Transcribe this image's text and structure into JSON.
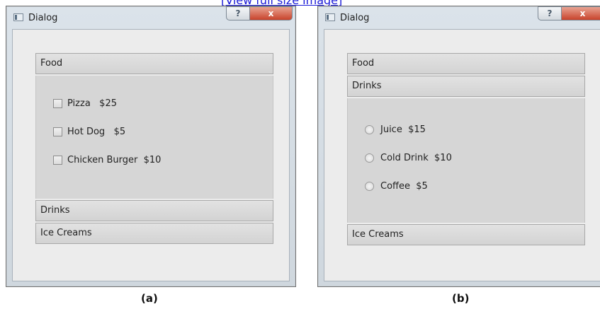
{
  "top_link": "[View full size image]",
  "windows": [
    {
      "title": "Dialog",
      "help_label": "?",
      "close_label": "x",
      "sections": [
        "Food",
        "Drinks",
        "Ice Creams"
      ],
      "options": [
        "Pizza   $25",
        "Hot Dog   $5",
        "Chicken Burger  $10"
      ]
    },
    {
      "title": "Dialog",
      "help_label": "?",
      "close_label": "x",
      "sections": [
        "Food",
        "Drinks",
        "Ice Creams"
      ],
      "options": [
        "Juice  $15",
        "Cold Drink  $10",
        "Coffee  $5"
      ]
    }
  ],
  "captions": [
    "(a)",
    "(b)"
  ]
}
